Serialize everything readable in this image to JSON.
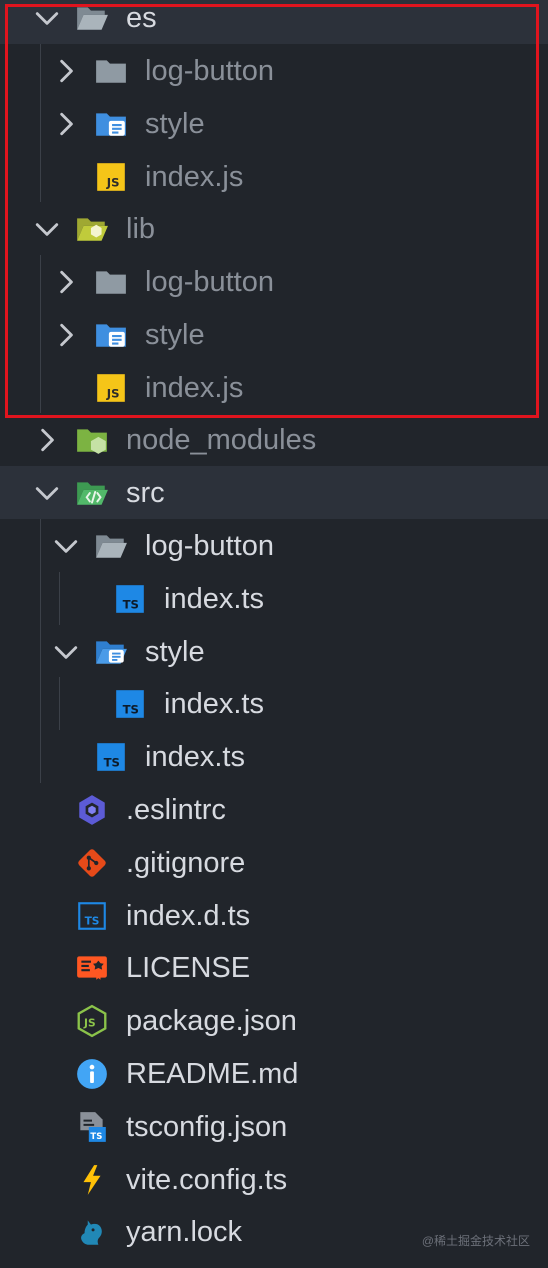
{
  "explorer": {
    "items": [
      {
        "label": "es",
        "icon": "folder-open-gray-icon",
        "expanded": true,
        "highlight": true
      },
      {
        "label": "log-button",
        "icon": "folder-gray-icon",
        "expanded": false
      },
      {
        "label": "style",
        "icon": "folder-style-blue-icon",
        "expanded": false
      },
      {
        "label": "index.js",
        "icon": "js-file-icon"
      },
      {
        "label": "lib",
        "icon": "folder-lib-open-icon",
        "expanded": true
      },
      {
        "label": "log-button",
        "icon": "folder-gray-icon",
        "expanded": false
      },
      {
        "label": "style",
        "icon": "folder-style-blue-icon",
        "expanded": false
      },
      {
        "label": "index.js",
        "icon": "js-file-icon"
      },
      {
        "label": "node_modules",
        "icon": "folder-node-icon",
        "expanded": false
      },
      {
        "label": "src",
        "icon": "folder-src-open-icon",
        "expanded": true,
        "highlight": true
      },
      {
        "label": "log-button",
        "icon": "folder-open-gray-icon",
        "expanded": true
      },
      {
        "label": "index.ts",
        "icon": "ts-file-icon"
      },
      {
        "label": "style",
        "icon": "folder-style-open-icon",
        "expanded": true
      },
      {
        "label": "index.ts",
        "icon": "ts-file-icon"
      },
      {
        "label": "index.ts",
        "icon": "ts-file-icon"
      },
      {
        "label": ".eslintrc",
        "icon": "eslint-icon"
      },
      {
        "label": ".gitignore",
        "icon": "git-icon"
      },
      {
        "label": "index.d.ts",
        "icon": "ts-definition-icon"
      },
      {
        "label": "LICENSE",
        "icon": "license-icon"
      },
      {
        "label": "package.json",
        "icon": "nodejs-icon"
      },
      {
        "label": "README.md",
        "icon": "info-icon"
      },
      {
        "label": "tsconfig.json",
        "icon": "tsconfig-icon"
      },
      {
        "label": "vite.config.ts",
        "icon": "vite-icon"
      },
      {
        "label": "yarn.lock",
        "icon": "yarn-icon"
      }
    ]
  },
  "watermark": "@稀土掘金技术社区",
  "colors": {
    "background": "#21252b",
    "row_highlight": "#2c313a",
    "text_dim": "#8a9099",
    "text_bright": "#d7dae0",
    "annotation_box": "#e0141e"
  }
}
